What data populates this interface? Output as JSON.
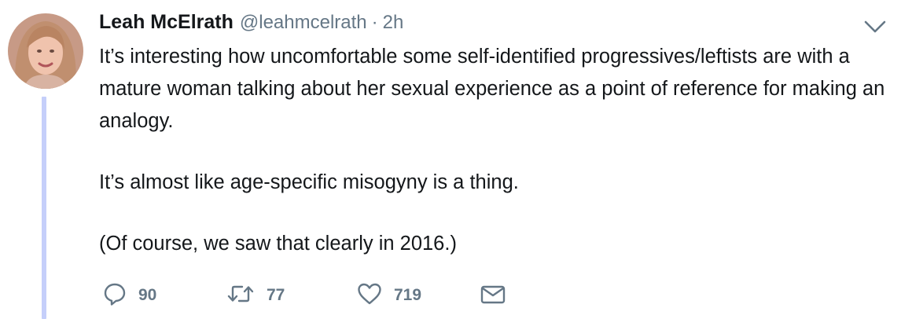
{
  "tweet": {
    "author_name": "Leah McElrath",
    "author_handle": "@leahmcelrath",
    "separator": "·",
    "time": "2h",
    "paragraphs": [
      "It’s interesting how uncomfortable some self-identified progressives/leftists are with a mature woman talking about her sexual experience as a point of reference for making an analogy.",
      "It’s almost like age-specific misogyny is a thing.",
      "(Of course, we saw that clearly in 2016.)"
    ],
    "actions": {
      "reply_count": "90",
      "retweet_count": "77",
      "like_count": "719"
    }
  },
  "icons": {
    "reply": "reply-icon",
    "retweet": "retweet-icon",
    "like": "heart-icon",
    "dm": "envelope-icon",
    "menu": "chevron-down-icon"
  },
  "colors": {
    "text": "#14171a",
    "secondary": "#657786",
    "thread_line": "#c5cffa"
  }
}
